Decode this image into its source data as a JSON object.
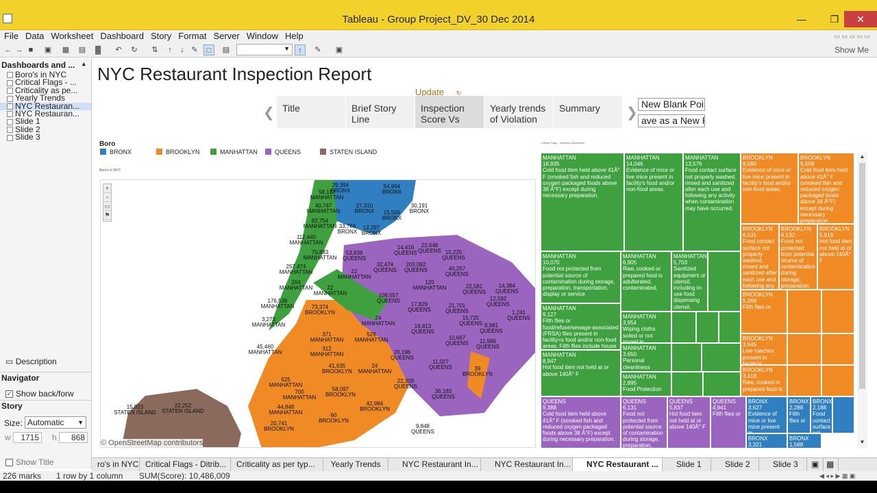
{
  "window": {
    "title": "Tableau - Group Project_DV_30 Dec 2014"
  },
  "menu": [
    "File",
    "Data",
    "Worksheet",
    "Dashboard",
    "Story",
    "Format",
    "Server",
    "Window",
    "Help"
  ],
  "toolbar": {
    "show_me": "Show Me"
  },
  "left_pane": {
    "header": "Dashboards and ...",
    "sheets": [
      "Boro's in NYC",
      "Critical Flags - ...",
      "Criticality as pe...",
      "Yearly Trends",
      "NYC Restauran...",
      "NYC Restauran...",
      "Slide 1",
      "Slide 2",
      "Slide 3"
    ],
    "description": "Description",
    "navigator": "Navigator",
    "show_back_forward": "Show back/forw",
    "story": "Story",
    "size_label": "Size:",
    "size_value": "Automatic",
    "w_label": "w",
    "w_value": "1715",
    "h_label": "h",
    "h_value": "868",
    "show_title": "Show Title"
  },
  "dashboard": {
    "title": "NYC Restaurant Inspection Report",
    "update": "Update",
    "story_points": [
      "Title",
      "Brief Story Line",
      "Inspection Score Vs",
      "Yearly trends of Violation",
      "Summary"
    ],
    "new_blank_point": "New Blank Point",
    "save_as_new_point": "ave as a New Poi"
  },
  "legend": {
    "title": "Boro",
    "items": [
      {
        "label": "BRONX",
        "color": "#2f7fc1"
      },
      {
        "label": "BROOKLYN",
        "color": "#f08a24"
      },
      {
        "label": "MANHATTAN",
        "color": "#3ea03e"
      },
      {
        "label": "QUEENS",
        "color": "#9a64bf"
      },
      {
        "label": "STATEN ISLAND",
        "color": "#8a6a5c"
      }
    ]
  },
  "map": {
    "subtitle": "Boro's in NYC",
    "copyright": "© OpenStreetMap contributors",
    "labels": [
      {
        "v": "29,394",
        "b": "BRONX"
      },
      {
        "v": "58,112",
        "b": "MANHATTAN"
      },
      {
        "v": "54,994",
        "b": "BRONX"
      },
      {
        "v": "40,747",
        "b": "MANHATTAN"
      },
      {
        "v": "27,310",
        "b": "BRONX"
      },
      {
        "v": "15,506",
        "b": "BRONX"
      },
      {
        "v": "30,191",
        "b": "BRONX"
      },
      {
        "v": "82,754",
        "b": "MANHATTAN"
      },
      {
        "v": "33,784",
        "b": "BRONX"
      },
      {
        "v": "12,297",
        "b": "BRONX"
      },
      {
        "v": "112,440",
        "b": "MANHATTAN"
      },
      {
        "v": "14,416",
        "b": "QUEENS"
      },
      {
        "v": "22,648",
        "b": "QUEENS"
      },
      {
        "v": "10,225",
        "b": "QUEENS"
      },
      {
        "v": "70,883",
        "b": "MANHATTAN"
      },
      {
        "v": "53,839",
        "b": "QUEENS"
      },
      {
        "v": "32,474",
        "b": "QUEENS"
      },
      {
        "v": "203,092",
        "b": "QUEENS"
      },
      {
        "v": "40,257",
        "b": "QUEENS"
      },
      {
        "v": "257,474",
        "b": "MANHATTAN"
      },
      {
        "v": "22",
        "b": "MANHATTAN"
      },
      {
        "v": "264",
        "b": "MANHATTAN"
      },
      {
        "v": "22",
        "b": "MANHATTAN"
      },
      {
        "v": "120",
        "b": "MANHATTAN"
      },
      {
        "v": "22,581",
        "b": "QUEENS"
      },
      {
        "v": "14,384",
        "b": "QUEENS"
      },
      {
        "v": "176,536",
        "b": "MANHATTAN"
      },
      {
        "v": "73,374",
        "b": "BROOKLYN"
      },
      {
        "v": "109,557",
        "b": "QUEENS"
      },
      {
        "v": "17,829",
        "b": "QUEENS"
      },
      {
        "v": "21,701",
        "b": "QUEENS"
      },
      {
        "v": "12,592",
        "b": "QUEENS"
      },
      {
        "v": "1,241",
        "b": "QUEENS"
      },
      {
        "v": "3,273",
        "b": "MANHATTAN"
      },
      {
        "v": "24",
        "b": "MANHATTAN"
      },
      {
        "v": "15,725",
        "b": "QUEENS"
      },
      {
        "v": "9,981",
        "b": "QUEENS"
      },
      {
        "v": "371",
        "b": "MANHATTAN"
      },
      {
        "v": "529",
        "b": "MANHATTAN"
      },
      {
        "v": "16,813",
        "b": "QUEENS"
      },
      {
        "v": "10,667",
        "b": "QUEENS"
      },
      {
        "v": "11,996",
        "b": "QUEENS"
      },
      {
        "v": "45,460",
        "b": "MANHATTAN"
      },
      {
        "v": "312",
        "b": "MANHATTAN"
      },
      {
        "v": "20,196",
        "b": "QUEENS"
      },
      {
        "v": "41,935",
        "b": "BROOKLYN"
      },
      {
        "v": "24",
        "b": "MANHATTAN"
      },
      {
        "v": "11,027",
        "b": "QUEENS"
      },
      {
        "v": "39",
        "b": "BROOKLYN"
      },
      {
        "v": "525",
        "b": "MANHATTAN"
      },
      {
        "v": "22,309",
        "b": "QUEENS"
      },
      {
        "v": "700",
        "b": "MANHATTAN"
      },
      {
        "v": "58,097",
        "b": "BROOKLYN"
      },
      {
        "v": "36,183",
        "b": "QUEENS"
      },
      {
        "v": "44,848",
        "b": "MANHATTAN"
      },
      {
        "v": "42,984",
        "b": "BROOKLYN"
      },
      {
        "v": "15,823",
        "b": "STATEN ISLAND"
      },
      {
        "v": "22,252",
        "b": "STATEN ISLAND"
      },
      {
        "v": "20,741",
        "b": "BROOKLYN"
      },
      {
        "v": "60",
        "b": "BROOKLYN"
      },
      {
        "v": "9,848",
        "b": "QUEENS"
      }
    ]
  },
  "treemap": {
    "subtitle": "Critical Flags - Violation Description",
    "tiles": [
      {
        "c": "m",
        "t": "MANHATTAN\n18,935\nCold food item held above 41Â° F (smoked fish and reduced oxygen packaged foods above 38 Â°F) except during necessary preparation."
      },
      {
        "c": "m",
        "t": "MANHATTAN\n14,046\nEvidence of mice or live mice present in facility's food and/or non-food areas."
      },
      {
        "c": "m",
        "t": "MANHATTAN\n13,576\nFood contact surface not properly washed, rinsed and sanitized after each use and following any activity when contamination may have occurred."
      },
      {
        "c": "b",
        "t": "BROOKLYN\n9,580\nEvidence of mice or live mice present in facility's food and/or non-food areas."
      },
      {
        "c": "b",
        "t": "BROOKLYN\n9,509\nCold food item held above 41Â° F (smoked fish and reduced oxygen packaged foods above 38 Â°F) except during necessary preparation."
      },
      {
        "c": "m",
        "t": "MANHATTAN\n10,070\nFood not protected from potential source of contamination during storage, preparation, transportation, display or service"
      },
      {
        "c": "m",
        "t": "MANHATTAN\n6,905\nRaw, cooked or prepared food is adulterated, contaminated,"
      },
      {
        "c": "m",
        "t": "MANHATTAN\n5,703\nSanitized equipment or utensil, including in-use food dispensing utensil,"
      },
      {
        "c": "m",
        "t": ""
      },
      {
        "c": "b",
        "t": "BROOKLYN\n6,531\nFood contact surface not properly washed, rinsed and sanitized after each use and following any activity"
      },
      {
        "c": "b",
        "t": "BROOKLYN\n6,132\nFood not protected from potential source of contamination during storage, preparation,"
      },
      {
        "c": "b",
        "t": "BROOKLYN\n5,919\nHot food item not held at or above 140Â° F"
      },
      {
        "c": "m",
        "t": "MANHATTAN\n9,127\nFilth flies or food/refuse/sewage-associated (FRSA) flies present in facility=s food and/or non-food areas. Filth flies include house"
      },
      {
        "c": "m",
        "t": "MANHATTAN\n3,954\nWiping cloths soiled or not stored in"
      },
      {
        "c": "m",
        "t": ""
      },
      {
        "c": "m",
        "t": ""
      },
      {
        "c": "m",
        "t": ""
      },
      {
        "c": "b",
        "t": "BROOKLYN\n5,266\nFilth flies or"
      },
      {
        "c": "b",
        "t": ""
      },
      {
        "c": "b",
        "t": ""
      },
      {
        "c": "m",
        "t": "MANHATTAN\n3,650\nPersonal cleanliness"
      },
      {
        "c": "m",
        "t": ""
      },
      {
        "c": "m",
        "t": ""
      },
      {
        "c": "m",
        "t": "MANHATTAN\n8,947\nHot food item not held at or above 140Â° F"
      },
      {
        "c": "m",
        "t": "MANHATTAN\n2,895\nFood Protection"
      },
      {
        "c": "m",
        "t": ""
      },
      {
        "c": "m",
        "t": ""
      },
      {
        "c": "b",
        "t": "BROOKLYN\n3,645\nLive roaches present in facility's"
      },
      {
        "c": "b",
        "t": ""
      },
      {
        "c": "b",
        "t": ""
      },
      {
        "c": "b",
        "t": "BROOKLYN\n3,418\nRaw, cooked or prepared food is"
      },
      {
        "c": "b",
        "t": ""
      },
      {
        "c": "b",
        "t": ""
      },
      {
        "c": "q",
        "t": "QUEENS\n9,388\nCold food item held above 41Â° F (smoked fish and reduced oxygen packaged foods above 38 Â°F) except during necessary preparation."
      },
      {
        "c": "q",
        "t": "QUEENS\n6,131\nFood not protected from potential source of contamination during storage, preparation,"
      },
      {
        "c": "q",
        "t": "QUEENS\n5,837\nHot food item not held at or above 140Â° F"
      },
      {
        "c": "q",
        "t": "QUEENS\n4,941\nFilth flies or"
      },
      {
        "c": "x",
        "t": "BRONX\n3,627\nEvidence of mice or live mice present in"
      },
      {
        "c": "x",
        "t": "BRONX\n2,288\nFilth flies or"
      },
      {
        "c": "x",
        "t": "BRONX\n2,188\nFood contact surface not"
      },
      {
        "c": "x",
        "t": ""
      },
      {
        "c": "x",
        "t": "BRONX\n3,321"
      },
      {
        "c": "x",
        "t": "BRONX\n1,588"
      }
    ]
  },
  "tabs": [
    "ro's in NYC",
    "Critical Flags - Ditrib...",
    "Criticality as per typ...",
    "Yearly Trends",
    "NYC Restaurant In...",
    "NYC Restaurant In...",
    "NYC Restaurant ...",
    "Slide 1",
    "Slide 2",
    "Slide 3"
  ],
  "status": {
    "marks": "226 marks",
    "rows": "1 row by 1 column",
    "sum": "SUM(Score): 10,486,009"
  }
}
